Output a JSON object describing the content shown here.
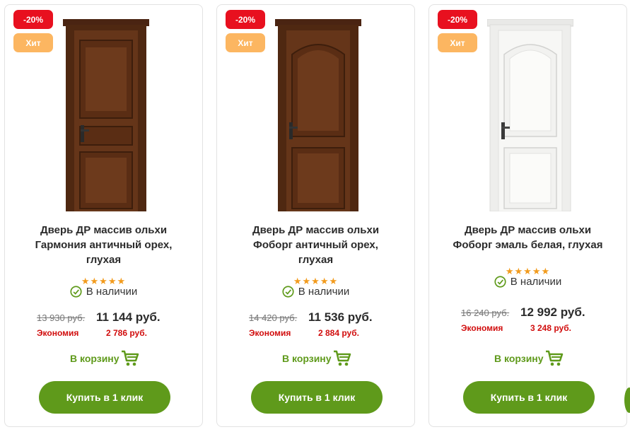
{
  "products": [
    {
      "badge_sale": "-20%",
      "badge_hit": "Хит",
      "title_line1": "Дверь ДР массив ольхи",
      "title_line2": "Гармония античный орех,",
      "title_line3": "глухая",
      "stars": "★★★★★",
      "rating": 5,
      "stock": "В наличии",
      "old_price": "13 930 руб.",
      "new_price": "11 144 руб.",
      "economy_label": "Экономия",
      "economy_value": "2 786 руб.",
      "cart_label": "В корзину",
      "buy_label": "Купить в 1 клик",
      "door_color": "#5a2f17"
    },
    {
      "badge_sale": "-20%",
      "badge_hit": "Хит",
      "title_line1": "Дверь ДР массив ольхи",
      "title_line2": "Фоборг античный орех,",
      "title_line3": "глухая",
      "stars": "★★★★★",
      "rating": 5,
      "stock": "В наличии",
      "old_price": "14 420 руб.",
      "new_price": "11 536 руб.",
      "economy_label": "Экономия",
      "economy_value": "2 884 руб.",
      "cart_label": "В корзину",
      "buy_label": "Купить в 1 клик",
      "door_color": "#5a2f17"
    },
    {
      "badge_sale": "-20%",
      "badge_hit": "Хит",
      "title_line1": "Дверь ДР массив ольхи",
      "title_line2": "Фоборг эмаль белая, глухая",
      "stars": "★★★★★",
      "rating": 5,
      "stock": "В наличии",
      "old_price": "16 240 руб.",
      "new_price": "12 992 руб.",
      "economy_label": "Экономия",
      "economy_value": "3 248 руб.",
      "cart_label": "В корзину",
      "buy_label": "Купить в 1 клик",
      "door_color": "#f4f4f2"
    }
  ],
  "colors": {
    "sale_badge": "#e8101f",
    "hit_badge": "#fcb661",
    "accent_green": "#5f9a1b",
    "economy_red": "#d10d0d",
    "star_orange": "#f29b1d"
  },
  "icons": [
    "check-circle-icon",
    "shopping-cart-icon",
    "star-icon"
  ]
}
